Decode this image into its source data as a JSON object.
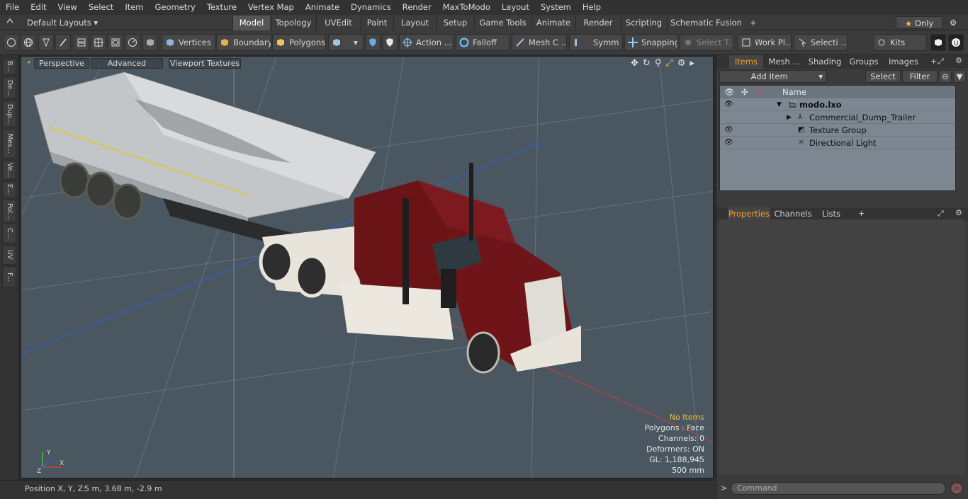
{
  "menu": [
    "File",
    "Edit",
    "View",
    "Select",
    "Item",
    "Geometry",
    "Texture",
    "Vertex Map",
    "Animate",
    "Dynamics",
    "Render",
    "MaxToModo",
    "Layout",
    "System",
    "Help"
  ],
  "layouts": {
    "label": "Default Layouts",
    "only_label": "Only"
  },
  "tabs": [
    "Model",
    "Topology",
    "UVEdit",
    "Paint",
    "Layout",
    "Setup",
    "Game Tools",
    "Animate",
    "Render",
    "Scripting",
    "Schematic Fusion"
  ],
  "toolbar": {
    "vertices": "Vertices",
    "boundary": "Boundary",
    "polygons": "Polygons",
    "action": "Action ...",
    "falloff": "Falloff",
    "mesh": "Mesh C ...",
    "symmetry": "Symm ...",
    "snapping": "Snapping",
    "select_tool": "Select T...",
    "workplane": "Work Pl...",
    "selection": "Selecti ...",
    "kits": "Kits"
  },
  "left_tabs": [
    "B...",
    "De...",
    "Dup...",
    "Mes...",
    "Ve...",
    "E...",
    "Pol...",
    "C...",
    "UV",
    "F..."
  ],
  "viewport": {
    "perspective": "Perspective",
    "advanced": "Advanced",
    "textures": "Viewport Textures",
    "stats": {
      "no_items": "No Items",
      "polygons": "Polygons : Face",
      "channels": "Channels: 0",
      "deformers": "Deformers: ON",
      "gl": "GL: 1,188,945",
      "scale": "500 mm"
    },
    "axis": {
      "x": "X",
      "y": "Y",
      "z": "Z"
    }
  },
  "status": {
    "label": "Position X, Y, Z:",
    "value": "5 m, 3.68 m, -2.9 m"
  },
  "right": {
    "tabs": [
      "Items",
      "Mesh ...",
      "Shading",
      "Groups",
      "Images"
    ],
    "add_item": "Add Item",
    "select": "Select",
    "filter": "Filter",
    "name_col": "Name",
    "items": [
      {
        "label": "modo.lxo",
        "bold": true,
        "level": 0,
        "eye": true,
        "expanded": true
      },
      {
        "label": "Commercial_Dump_Trailer",
        "level": 1,
        "eye": false,
        "expandable": true
      },
      {
        "label": "Texture Group",
        "level": 1,
        "eye": true
      },
      {
        "label": "Directional Light",
        "level": 1,
        "eye": true
      }
    ],
    "prop_tabs": [
      "Properties",
      "Channels",
      "Lists"
    ],
    "command_placeholder": "Command"
  },
  "colors": {
    "accent": "#f0a030",
    "viewport": "#4a5660",
    "truck_red": "#6a1418",
    "trailer": "#c8cacc"
  }
}
